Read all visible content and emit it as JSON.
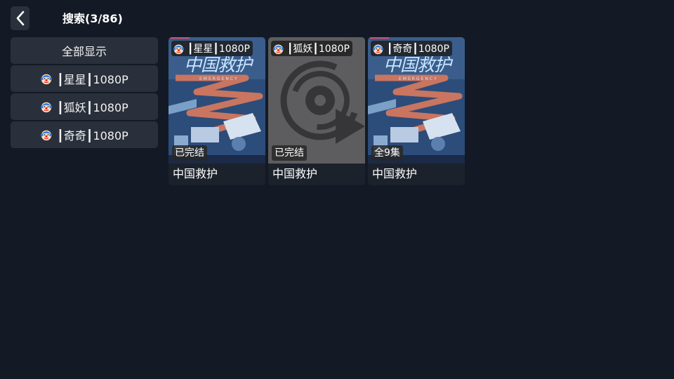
{
  "header": {
    "back_icon": "chevron-left-icon",
    "title": "搜索(3/86)"
  },
  "filters": {
    "show_all_label": "全部显示",
    "items": [
      {
        "icon": "clown-emoji-icon",
        "label": "┃星星┃1080P"
      },
      {
        "icon": "clown-emoji-icon",
        "label": "┃狐妖┃1080P"
      },
      {
        "icon": "clown-emoji-icon",
        "label": "┃奇奇┃1080P"
      }
    ]
  },
  "results": [
    {
      "source": "┃星星┃1080P",
      "status": "已完结",
      "title": "中国救护",
      "poster": "poster-image",
      "poster_text": "中国救护",
      "poster_subtext": "EMERGENCY"
    },
    {
      "source": "┃狐妖┃1080P",
      "status": "已完结",
      "title": "中国救护",
      "poster": "video-placeholder-icon"
    },
    {
      "source": "┃奇奇┃1080P",
      "status": "全9集",
      "title": "中国救护",
      "poster": "poster-image",
      "poster_text": "中国救护",
      "poster_subtext": "EMERGENCY"
    }
  ],
  "colors": {
    "background": "#131a25",
    "filter_bg": "#29303b",
    "placeholder_bg": "#5d5d5f"
  }
}
